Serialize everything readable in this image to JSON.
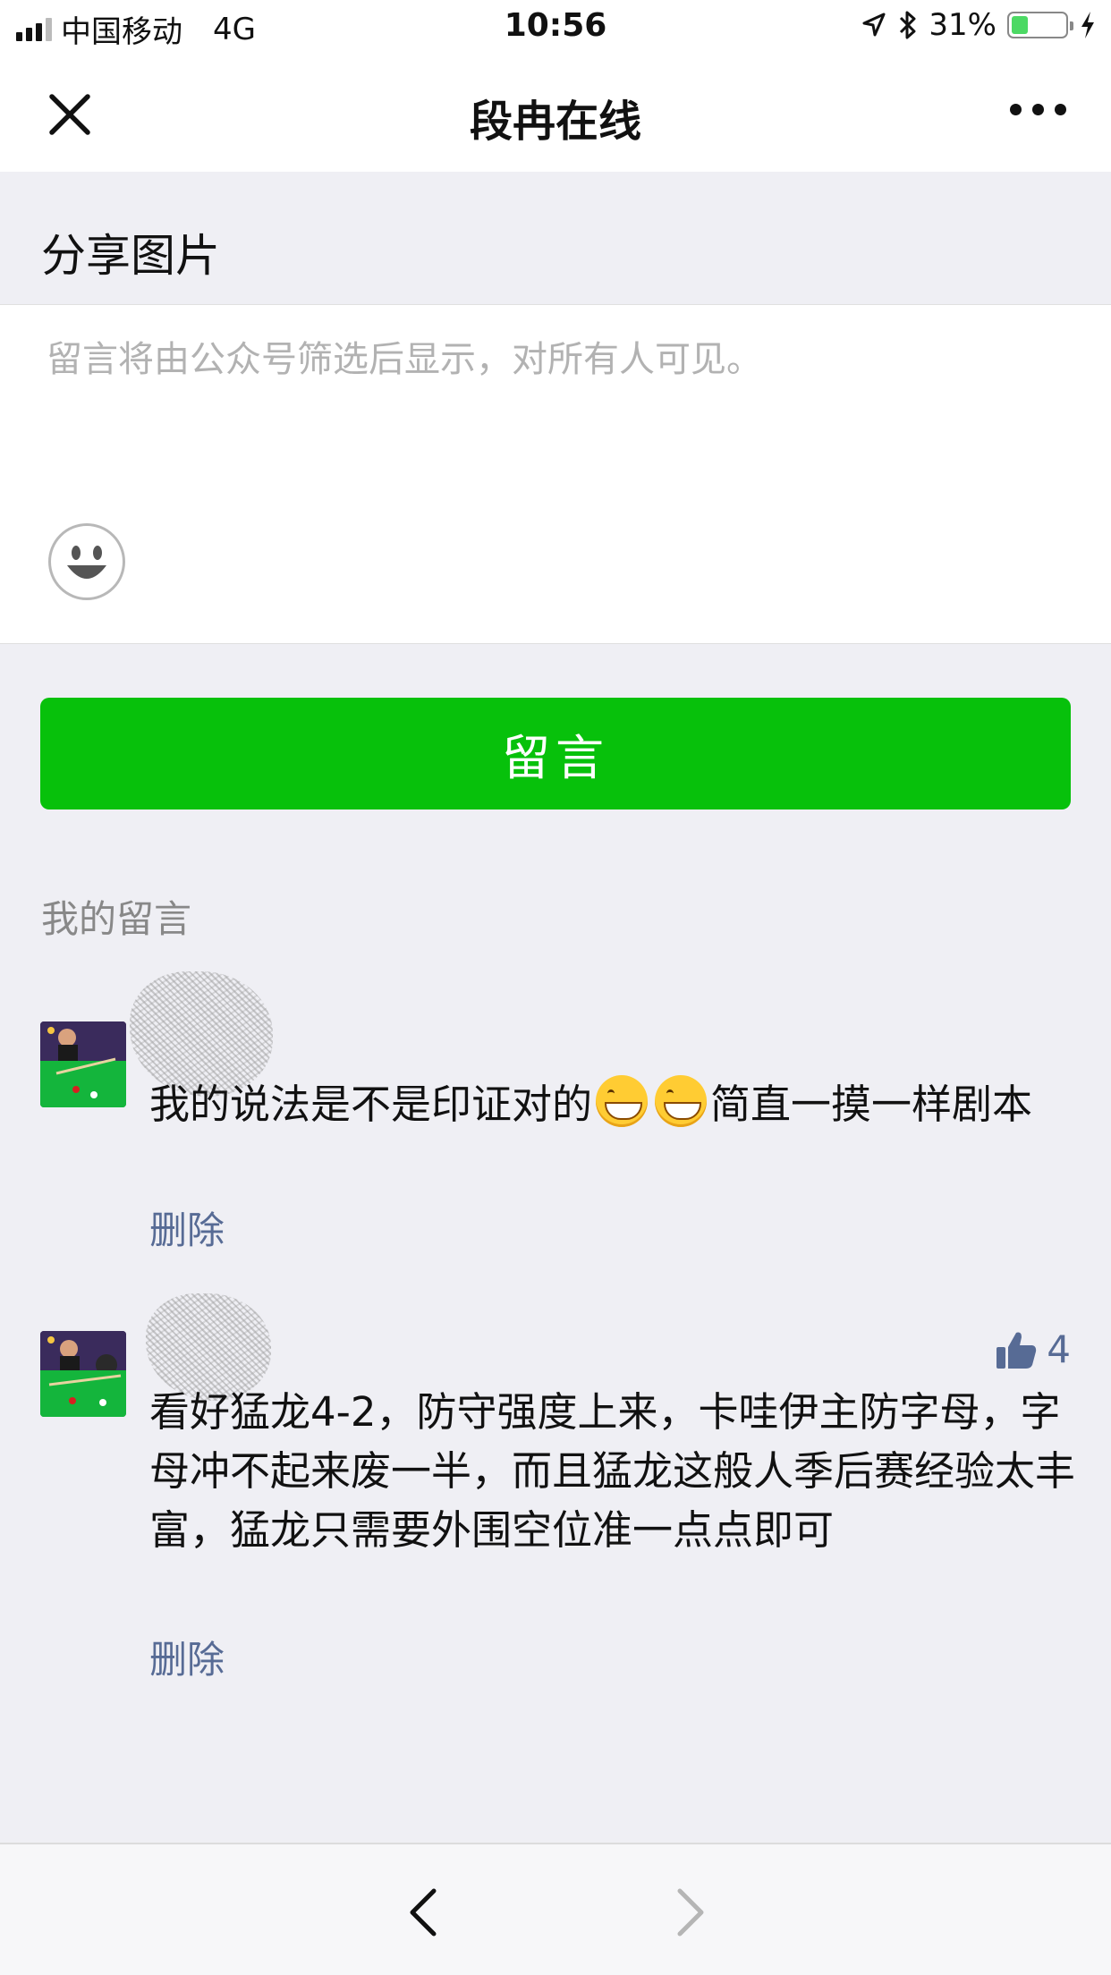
{
  "status_bar": {
    "carrier": "中国移动",
    "network": "4G",
    "time": "10:56",
    "battery": "31%",
    "battery_level": 0.31
  },
  "nav": {
    "title": "段冉在线"
  },
  "section": {
    "title": "分享图片"
  },
  "comment_box": {
    "placeholder": "留言将由公众号筛选后显示，对所有人可见。"
  },
  "submit": {
    "label": "留言"
  },
  "my_comments": {
    "title": "我的留言",
    "items": [
      {
        "text_before_emoji": "我的说法是不是印证对的",
        "text_after_emoji": "简直一摸一样剧本",
        "delete_label": "删除"
      },
      {
        "text": "看好猛龙4-2，防守强度上来，卡哇伊主防字母，字母冲不起来废一半，而且猛龙这般人季后赛经验太丰富，猛龙只需要外围空位准一点点即可",
        "delete_label": "删除",
        "likes": "4"
      }
    ]
  },
  "colors": {
    "accent_green": "#07c10b",
    "link_blue": "#576b95",
    "background": "#efeff4"
  }
}
